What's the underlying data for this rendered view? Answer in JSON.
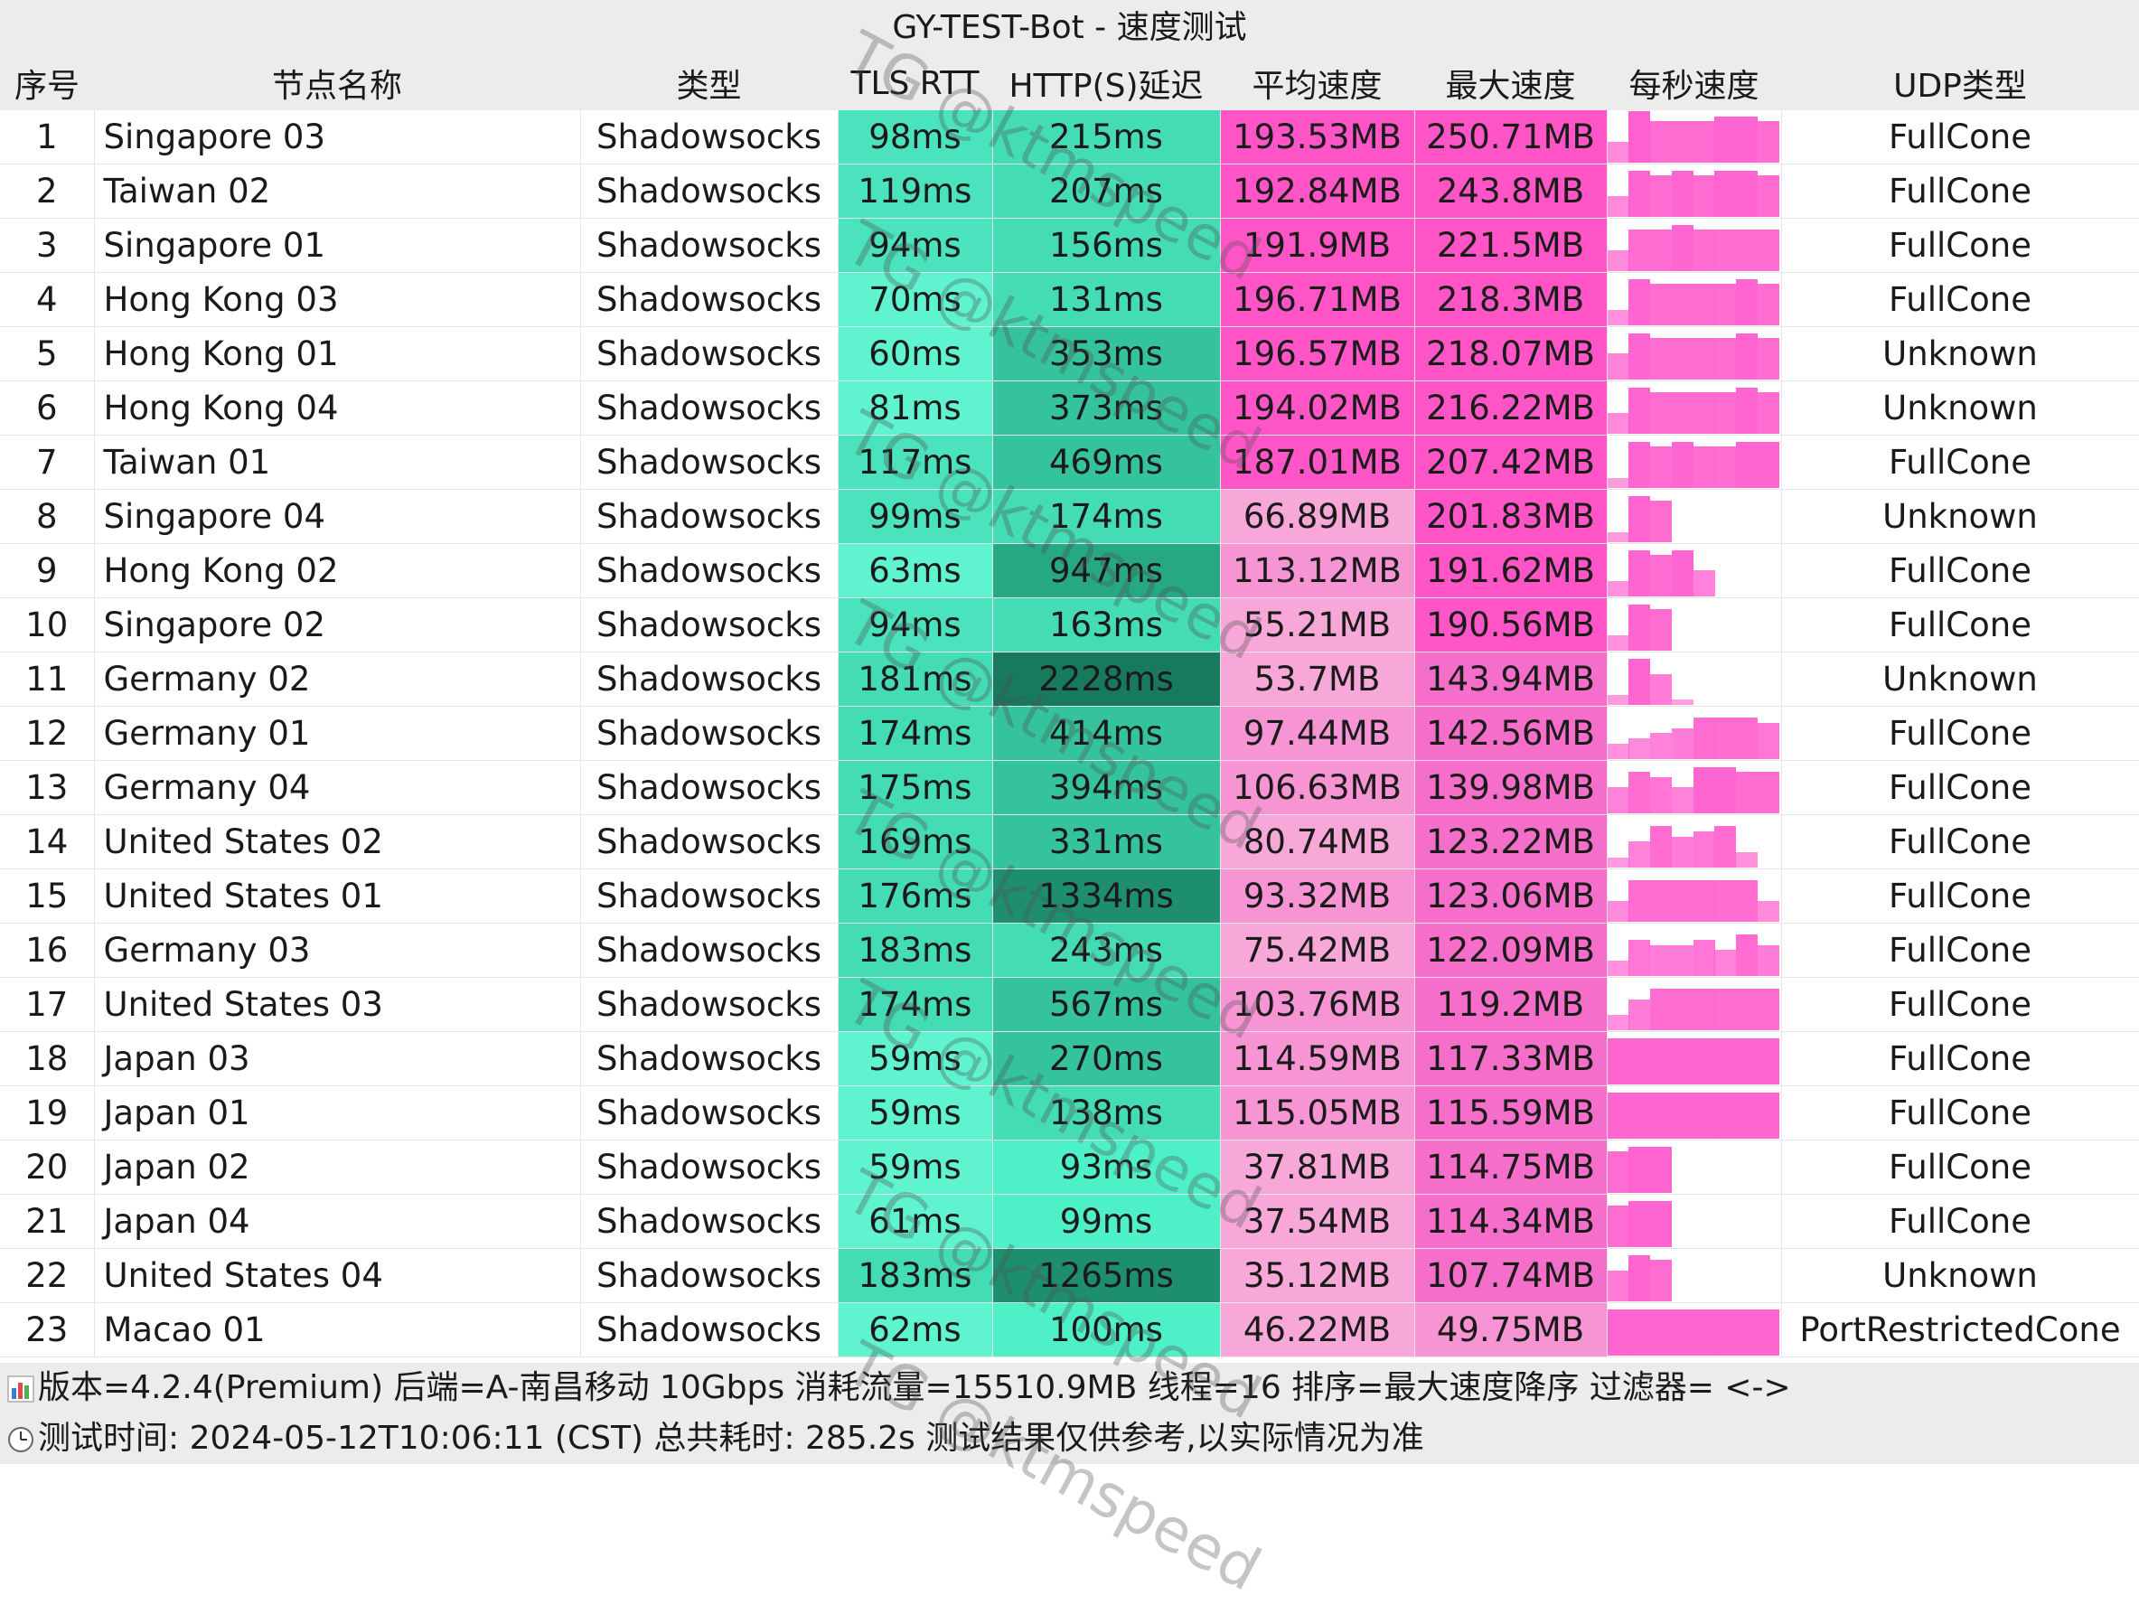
{
  "title": "GY-TEST-Bot - 速度测试",
  "columns": [
    "序号",
    "节点名称",
    "类型",
    "TLS RTT",
    "HTTP(S)延迟",
    "平均速度",
    "最大速度",
    "每秒速度",
    "UDP类型"
  ],
  "rows": [
    {
      "idx": "1",
      "name": "Singapore 03",
      "type": "Shadowsocks",
      "tls": "98ms",
      "http": "215ms",
      "avg": "193.53MB",
      "max": "250.71MB",
      "udp": "FullCone",
      "spark": [
        0.4,
        1,
        0.8,
        0.8,
        0.8,
        0.9,
        0.9,
        0.8
      ]
    },
    {
      "idx": "2",
      "name": "Taiwan 02",
      "type": "Shadowsocks",
      "tls": "119ms",
      "http": "207ms",
      "avg": "192.84MB",
      "max": "243.8MB",
      "udp": "FullCone",
      "spark": [
        0.4,
        0.9,
        0.8,
        0.9,
        0.8,
        0.9,
        0.9,
        0.8
      ]
    },
    {
      "idx": "3",
      "name": "Singapore 01",
      "type": "Shadowsocks",
      "tls": "94ms",
      "http": "156ms",
      "avg": "191.9MB",
      "max": "221.5MB",
      "udp": "FullCone",
      "spark": [
        0.4,
        0.8,
        0.8,
        0.9,
        0.8,
        0.8,
        0.8,
        0.8
      ]
    },
    {
      "idx": "4",
      "name": "Hong Kong 03",
      "type": "Shadowsocks",
      "tls": "70ms",
      "http": "131ms",
      "avg": "196.71MB",
      "max": "218.3MB",
      "udp": "FullCone",
      "spark": [
        0.3,
        0.9,
        0.8,
        0.8,
        0.8,
        0.8,
        0.9,
        0.8
      ]
    },
    {
      "idx": "5",
      "name": "Hong Kong 01",
      "type": "Shadowsocks",
      "tls": "60ms",
      "http": "353ms",
      "avg": "196.57MB",
      "max": "218.07MB",
      "udp": "Unknown",
      "spark": [
        0.5,
        0.9,
        0.8,
        0.8,
        0.8,
        0.8,
        0.9,
        0.8
      ]
    },
    {
      "idx": "6",
      "name": "Hong Kong 04",
      "type": "Shadowsocks",
      "tls": "81ms",
      "http": "373ms",
      "avg": "194.02MB",
      "max": "216.22MB",
      "udp": "Unknown",
      "spark": [
        0.4,
        0.9,
        0.8,
        0.8,
        0.8,
        0.8,
        0.9,
        0.8
      ]
    },
    {
      "idx": "7",
      "name": "Taiwan 01",
      "type": "Shadowsocks",
      "tls": "117ms",
      "http": "469ms",
      "avg": "187.01MB",
      "max": "207.42MB",
      "udp": "FullCone",
      "spark": [
        0.2,
        0.9,
        0.8,
        0.9,
        0.8,
        0.8,
        0.9,
        0.9
      ]
    },
    {
      "idx": "8",
      "name": "Singapore 04",
      "type": "Shadowsocks",
      "tls": "99ms",
      "http": "174ms",
      "avg": "66.89MB",
      "max": "201.83MB",
      "udp": "Unknown",
      "spark": [
        0.2,
        0.9,
        0.8,
        0,
        0,
        0,
        0,
        0
      ]
    },
    {
      "idx": "9",
      "name": "Hong Kong 02",
      "type": "Shadowsocks",
      "tls": "63ms",
      "http": "947ms",
      "avg": "113.12MB",
      "max": "191.62MB",
      "udp": "FullCone",
      "spark": [
        0.3,
        0.9,
        0.8,
        0.9,
        0.5,
        0,
        0,
        0
      ]
    },
    {
      "idx": "10",
      "name": "Singapore 02",
      "type": "Shadowsocks",
      "tls": "94ms",
      "http": "163ms",
      "avg": "55.21MB",
      "max": "190.56MB",
      "udp": "FullCone",
      "spark": [
        0.3,
        0.9,
        0.8,
        0,
        0,
        0,
        0,
        0
      ]
    },
    {
      "idx": "11",
      "name": "Germany 02",
      "type": "Shadowsocks",
      "tls": "181ms",
      "http": "2228ms",
      "avg": "53.7MB",
      "max": "143.94MB",
      "udp": "Unknown",
      "spark": [
        0.2,
        0.9,
        0.6,
        0.1,
        0,
        0,
        0,
        0
      ]
    },
    {
      "idx": "12",
      "name": "Germany 01",
      "type": "Shadowsocks",
      "tls": "174ms",
      "http": "414ms",
      "avg": "97.44MB",
      "max": "142.56MB",
      "udp": "FullCone",
      "spark": [
        0.3,
        0.4,
        0.5,
        0.6,
        0.8,
        0.8,
        0.8,
        0.7
      ]
    },
    {
      "idx": "13",
      "name": "Germany 04",
      "type": "Shadowsocks",
      "tls": "175ms",
      "http": "394ms",
      "avg": "106.63MB",
      "max": "139.98MB",
      "udp": "FullCone",
      "spark": [
        0.5,
        0.8,
        0.7,
        0.5,
        0.9,
        0.9,
        0.8,
        0.8
      ]
    },
    {
      "idx": "14",
      "name": "United States 02",
      "type": "Shadowsocks",
      "tls": "169ms",
      "http": "331ms",
      "avg": "80.74MB",
      "max": "123.22MB",
      "udp": "FullCone",
      "spark": [
        0.2,
        0.5,
        0.8,
        0.6,
        0.7,
        0.8,
        0.3,
        0
      ]
    },
    {
      "idx": "15",
      "name": "United States 01",
      "type": "Shadowsocks",
      "tls": "176ms",
      "http": "1334ms",
      "avg": "93.32MB",
      "max": "123.06MB",
      "udp": "FullCone",
      "spark": [
        0.4,
        0.8,
        0.8,
        0.8,
        0.8,
        0.8,
        0.8,
        0.4
      ]
    },
    {
      "idx": "16",
      "name": "Germany 03",
      "type": "Shadowsocks",
      "tls": "183ms",
      "http": "243ms",
      "avg": "75.42MB",
      "max": "122.09MB",
      "udp": "FullCone",
      "spark": [
        0.3,
        0.7,
        0.6,
        0.6,
        0.7,
        0.5,
        0.8,
        0.6
      ]
    },
    {
      "idx": "17",
      "name": "United States 03",
      "type": "Shadowsocks",
      "tls": "174ms",
      "http": "567ms",
      "avg": "103.76MB",
      "max": "119.2MB",
      "udp": "FullCone",
      "spark": [
        0.3,
        0.6,
        0.8,
        0.8,
        0.8,
        0.8,
        0.8,
        0.8
      ]
    },
    {
      "idx": "18",
      "name": "Japan 03",
      "type": "Shadowsocks",
      "tls": "59ms",
      "http": "270ms",
      "avg": "114.59MB",
      "max": "117.33MB",
      "udp": "FullCone",
      "spark": [
        0.9,
        0.9,
        0.9,
        0.9,
        0.9,
        0.9,
        0.9,
        0.9
      ]
    },
    {
      "idx": "19",
      "name": "Japan 01",
      "type": "Shadowsocks",
      "tls": "59ms",
      "http": "138ms",
      "avg": "115.05MB",
      "max": "115.59MB",
      "udp": "FullCone",
      "spark": [
        0.9,
        0.9,
        0.9,
        0.9,
        0.9,
        0.9,
        0.9,
        0.9
      ]
    },
    {
      "idx": "20",
      "name": "Japan 02",
      "type": "Shadowsocks",
      "tls": "59ms",
      "http": "93ms",
      "avg": "37.81MB",
      "max": "114.75MB",
      "udp": "FullCone",
      "spark": [
        0.8,
        0.9,
        0.9,
        0,
        0,
        0,
        0,
        0
      ]
    },
    {
      "idx": "21",
      "name": "Japan 04",
      "type": "Shadowsocks",
      "tls": "61ms",
      "http": "99ms",
      "avg": "37.54MB",
      "max": "114.34MB",
      "udp": "FullCone",
      "spark": [
        0.8,
        0.9,
        0.9,
        0,
        0,
        0,
        0,
        0
      ]
    },
    {
      "idx": "22",
      "name": "United States 04",
      "type": "Shadowsocks",
      "tls": "183ms",
      "http": "1265ms",
      "avg": "35.12MB",
      "max": "107.74MB",
      "udp": "Unknown",
      "spark": [
        0.6,
        0.9,
        0.8,
        0,
        0,
        0,
        0,
        0
      ]
    },
    {
      "idx": "23",
      "name": "Macao 01",
      "type": "Shadowsocks",
      "tls": "62ms",
      "http": "100ms",
      "avg": "46.22MB",
      "max": "49.75MB",
      "udp": "PortRestrictedCone",
      "spark": [
        0.9,
        0.9,
        0.9,
        0.9,
        0.9,
        0.9,
        0.9,
        0.9
      ]
    }
  ],
  "footer": {
    "line1": "版本=4.2.4(Premium)  后端=A-南昌移动 10Gbps  消耗流量=15510.9MB  线程=16  排序=最大速度降序  过滤器= <->",
    "line2": "测试时间: 2024-05-12T10:06:11 (CST) 总共耗时: 285.2s 测试结果仅供参考,以实际情况为准"
  },
  "watermark": "TG @ktmspeed",
  "icons": {
    "footer_line1": "bar-chart-icon",
    "footer_line2": "clock-icon"
  },
  "colors": {
    "header_bg": "#ececec",
    "tls_bg": [
      "#5ff4cf",
      "#4ae3bd",
      "#44dcb4"
    ],
    "http_bg": [
      "#4ef0c8",
      "#44dcb4",
      "#34c39c",
      "#26a882",
      "#1e8f6e",
      "#177a5c"
    ],
    "avg_bg": [
      "#ff55c7",
      "#f795d4",
      "#f8a8d8"
    ],
    "max_bg": [
      "#ff55c7",
      "#f56ec9",
      "#f795d4"
    ],
    "spark": "#ff5fcf"
  }
}
